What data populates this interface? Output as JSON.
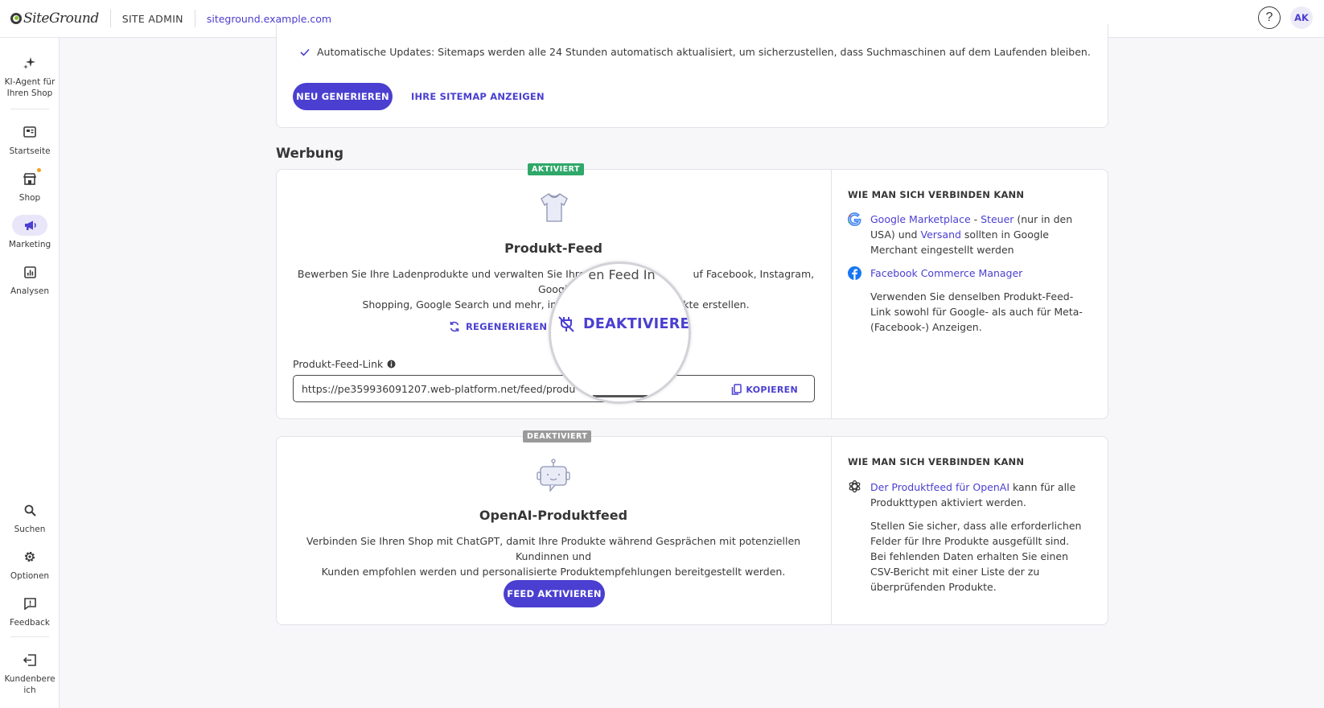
{
  "topbar": {
    "logo_text": "SiteGround",
    "site_admin": "SITE ADMIN",
    "domain": "siteground.example.com",
    "help_label": "?",
    "avatar_initials": "AK"
  },
  "sidebar": {
    "items": [
      {
        "label": "KI-Agent für Ihren Shop",
        "icon": "sparkle-icon"
      },
      {
        "label": "Startseite",
        "icon": "dashboard-icon"
      },
      {
        "label": "Shop",
        "icon": "store-icon"
      },
      {
        "label": "Marketing",
        "icon": "megaphone-icon"
      },
      {
        "label": "Analysen",
        "icon": "chart-icon"
      },
      {
        "label": "Suchen",
        "icon": "search-icon"
      },
      {
        "label": "Optionen",
        "icon": "gear-icon"
      },
      {
        "label": "Feedback",
        "icon": "feedback-icon"
      },
      {
        "label": "Kundenbereich",
        "icon": "logout-icon"
      }
    ]
  },
  "sitemap": {
    "auto_updates": "Automatische Updates: Sitemaps werden alle 24 Stunden automatisch aktualisiert, um sicherzustellen, dass Suchmaschinen auf dem Laufenden bleiben.",
    "regenerate_button": "NEU GENERIEREN",
    "view_link": "IHRE SITEMAP ANZEIGEN"
  },
  "werbung": {
    "section_title": "Werbung",
    "product_feed": {
      "badge": "AKTIVIERT",
      "title": "Produkt-Feed",
      "description": "Bewerben Sie Ihre Ladenprodukte und verwalten Sie Ihre Ver... auf Facebook, Instagram, Google Shopping, Google Search und mehr, indem ... dukte erstellen.",
      "desc_line1": "Bewerben Sie Ihre Ladenprodukte und verwalten Sie Ihre Ve",
      "desc_line1b": "uf Facebook, Instagram, Google",
      "desc_line2": "Shopping, Google Search und mehr, indem",
      "desc_line2b": "lukte erstellen.",
      "regenerate": "REGENERIEREN",
      "deactivate": "DEAKTIVIEREN",
      "feed_link_label": "Produkt-Feed-Link",
      "feed_url": "https://pe359936091207.web-platform.net/feed/products.xml",
      "copy": "KOPIEREN",
      "magnifier_text": "en Feed In"
    },
    "product_feed_how": {
      "title": "WIE MAN SICH VERBINDEN KANN",
      "google_marketplace": "Google Marketplace",
      "dash": " - ",
      "tax": "Steuer",
      "us_only": " (nur in den USA) und ",
      "shipping": "Versand",
      "google_rest": " sollten in Google Merchant eingestellt werden",
      "facebook_manager": "Facebook Commerce Manager",
      "facebook_text": "Verwenden Sie denselben Produkt-Feed-Link sowohl für Google- als auch für Meta-(Facebook-) Anzeigen."
    },
    "openai_feed": {
      "badge": "DEAKTIVIERT",
      "title": "OpenAI-Produktfeed",
      "desc_line1": "Verbinden Sie Ihren Shop mit ChatGPT, damit Ihre Produkte während Gesprächen mit potenziellen Kundinnen und",
      "desc_line2": "Kunden empfohlen werden und personalisierte Produktempfehlungen bereitgestellt werden.",
      "activate": "FEED AKTIVIEREN"
    },
    "openai_how": {
      "title": "WIE MAN SICH VERBINDEN KANN",
      "openai_link": "Der Produktfeed für OpenAI",
      "openai_rest": " kann für alle Produkttypen aktiviert werden.",
      "fields_text": "Stellen Sie sicher, dass alle erforderlichen Felder für Ihre Produkte ausgefüllt sind. Bei fehlenden Daten erhalten Sie einen CSV-Bericht mit einer Liste der zu überprüfenden Produkte."
    }
  },
  "colors": {
    "accent": "#4a3fd0",
    "activated_badge": "#2fa86a",
    "deactivated_badge": "#9a9a9a"
  }
}
